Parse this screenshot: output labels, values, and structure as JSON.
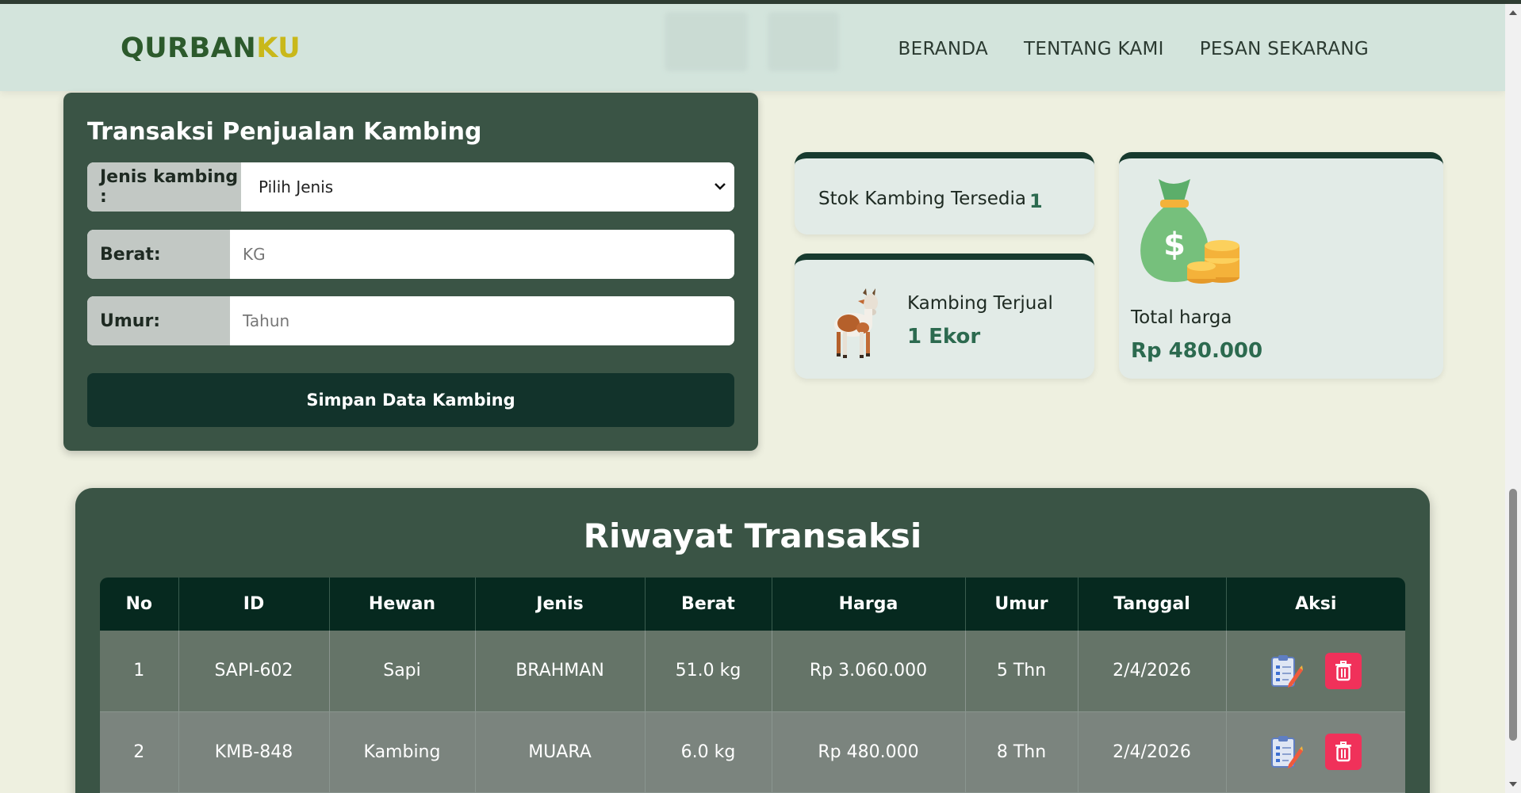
{
  "brand": {
    "part1": "QURBAN",
    "part2": "KU"
  },
  "nav": {
    "items": [
      "BERANDA",
      "TENTANG KAMI",
      "PESAN SEKARANG"
    ]
  },
  "form": {
    "title": "Transaksi Penjualan Kambing",
    "jenis_label": "Jenis kambing :",
    "jenis_value": "Pilih Jenis",
    "berat_label": "Berat:",
    "berat_placeholder": "KG",
    "umur_label": "Umur:",
    "umur_placeholder": "Tahun",
    "save_label": "Simpan Data Kambing"
  },
  "stats": {
    "stok_label": "Stok Kambing Tersedia",
    "stok_value": "1",
    "jual_label": "Kambing Terjual",
    "jual_value": "1 Ekor",
    "total_label": "Total harga",
    "total_value": "Rp 480.000"
  },
  "history": {
    "title": "Riwayat Transaksi",
    "headers": [
      "No",
      "ID",
      "Hewan",
      "Jenis",
      "Berat",
      "Harga",
      "Umur",
      "Tanggal",
      "Aksi"
    ],
    "rows": [
      [
        "1",
        "SAPI-602",
        "Sapi",
        "BRAHMAN",
        "51.0 kg",
        "Rp 3.060.000",
        "5 Thn",
        "2/4/2026"
      ],
      [
        "2",
        "KMB-848",
        "Kambing",
        "MUARA",
        "6.0 kg",
        "Rp 480.000",
        "8 Thn",
        "2/4/2026"
      ]
    ]
  },
  "colors": {
    "accent_dark": "#173a2e",
    "card_green": "#3a5445",
    "brand_yellow": "#c9b81a",
    "delete_red": "#f0315a"
  },
  "icons": [
    "chevron-down-icon",
    "goat-icon",
    "money-bag-icon",
    "edit-clipboard-icon",
    "trash-icon"
  ]
}
